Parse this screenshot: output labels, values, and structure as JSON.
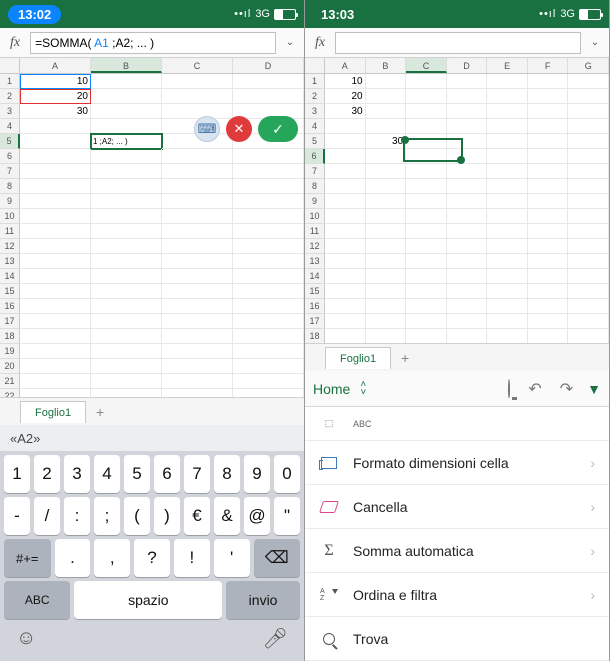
{
  "left": {
    "status": {
      "time": "13:02",
      "network": "3G"
    },
    "formula": {
      "prefix": "=SOMMA( ",
      "ref1": "A1",
      "mid": " ;A2; ... )"
    },
    "columns": [
      "A",
      "B",
      "C",
      "D"
    ],
    "cells": {
      "A1": "10",
      "A2": "20",
      "A3": "30",
      "B5": "1 ;A2; ... )"
    },
    "sheet_tab": "Foglio1",
    "keyboard": {
      "suggestion": "«A2»",
      "row1": [
        "1",
        "2",
        "3",
        "4",
        "5",
        "6",
        "7",
        "8",
        "9",
        "0"
      ],
      "row2": [
        "-",
        "/",
        ":",
        ";",
        "(",
        ")",
        "€",
        "&",
        "@",
        "\""
      ],
      "num_toggle": "#+=",
      "row3": [
        ".",
        ",",
        "?",
        "!",
        "'"
      ],
      "abc": "ABC",
      "space": "spazio",
      "enter": "invio"
    }
  },
  "right": {
    "status": {
      "time": "13:03",
      "network": "3G"
    },
    "columns": [
      "A",
      "B",
      "C",
      "D",
      "E",
      "F",
      "G"
    ],
    "cells": {
      "A1": "10",
      "A2": "20",
      "A3": "30",
      "B5_partial": "30"
    },
    "sheet_tab": "Foglio1",
    "ribbon_tab": "Home",
    "menu": {
      "abc_label": "ABC",
      "cell_format": "Formato dimensioni cella",
      "clear": "Cancella",
      "autosum": "Somma automatica",
      "sort_filter": "Ordina e filtra",
      "find": "Trova"
    }
  }
}
